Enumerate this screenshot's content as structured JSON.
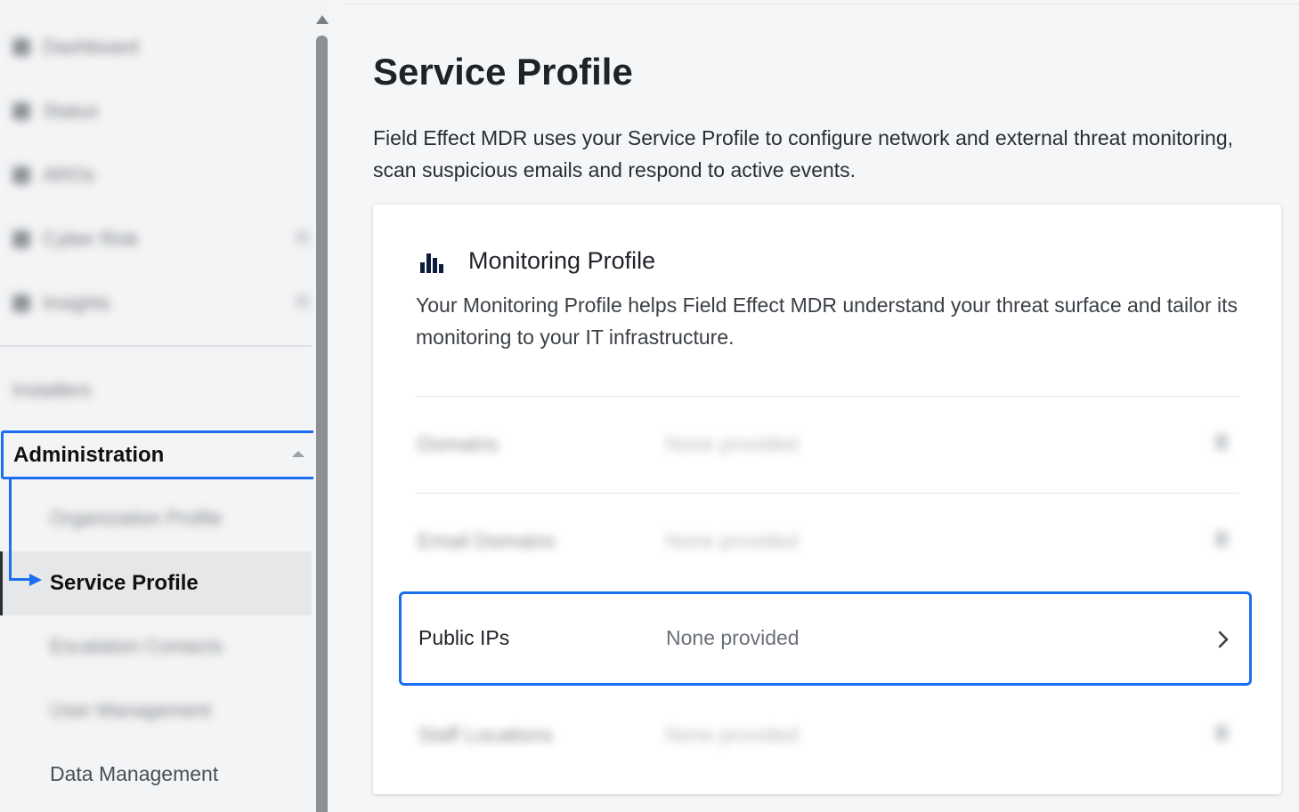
{
  "sidebar": {
    "nav_items": [
      {
        "label": "Dashboard",
        "icon": "dashboard-icon"
      },
      {
        "label": "Status",
        "icon": "status-icon"
      },
      {
        "label": "AROs",
        "icon": "aro-icon"
      },
      {
        "label": "Cyber Risk",
        "icon": "cyber-risk-icon"
      },
      {
        "label": "Insights",
        "icon": "insights-icon"
      }
    ],
    "installers_label": "Installers",
    "admin_label": "Administration",
    "admin_items": [
      {
        "label": "Organization Profile"
      },
      {
        "label": "Service Profile"
      },
      {
        "label": "Escalation Contacts"
      },
      {
        "label": "User Management"
      },
      {
        "label": "Data Management"
      }
    ]
  },
  "main": {
    "title": "Service Profile",
    "description": "Field Effect MDR uses your Service Profile to configure network and external threat monitoring, scan suspicious emails and respond to active events.",
    "card": {
      "icon": "bar-chart-icon",
      "title": "Monitoring Profile",
      "description": "Your Monitoring Profile helps Field Effect MDR understand your threat surface and tailor its monitoring to your IT infrastructure.",
      "rows": [
        {
          "label": "Domains",
          "value": "None provided"
        },
        {
          "label": "Email Domains",
          "value": "None provided"
        },
        {
          "label": "Public IPs",
          "value": "None provided"
        },
        {
          "label": "Staff Locations",
          "value": "None provided"
        }
      ]
    }
  },
  "colors": {
    "highlight": "#1a6ff0",
    "icon_navy": "#0d1b3e"
  }
}
